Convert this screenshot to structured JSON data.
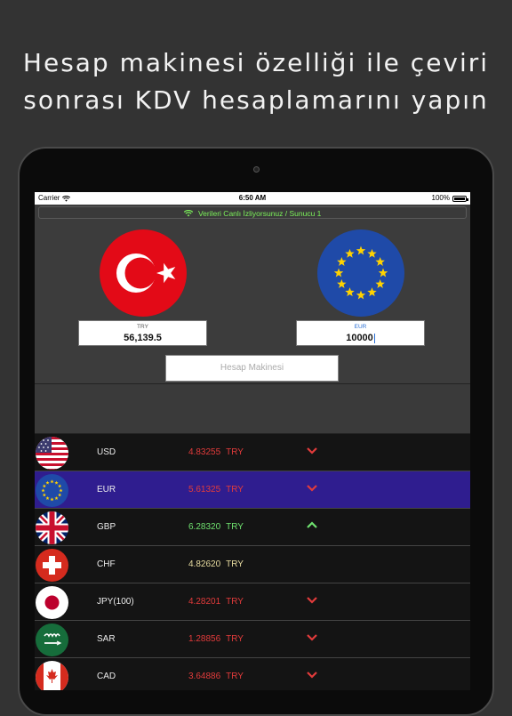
{
  "headline": {
    "line1": "Hesap makinesi özelliği ile çeviri",
    "line2": "sonrası KDV hesaplamarını yapın"
  },
  "status_bar": {
    "carrier": "Carrier",
    "time": "6:50 AM",
    "battery": "100%"
  },
  "live_banner": "Verileri Canlı İzliyorsunuz / Sunucu 1",
  "converter": {
    "from": {
      "code": "TRY",
      "value": "56,139.5",
      "flag": "turkey-flag"
    },
    "to": {
      "code": "EUR",
      "value": "10000",
      "flag": "eu-flag"
    }
  },
  "calculator_button": "Hesap Makinesi",
  "colors": {
    "up": "#6fe26f",
    "down": "#e23b3b",
    "neutral": "#e8dca0",
    "selected_row": "#2f1d8f",
    "live_text": "#7cf25a"
  },
  "rates": [
    {
      "code": "USD",
      "rate": "4.83255",
      "unit": "TRY",
      "trend": "down",
      "icon": "us-flag-icon"
    },
    {
      "code": "EUR",
      "rate": "5.61325",
      "unit": "TRY",
      "trend": "down",
      "icon": "eu-flag-icon",
      "selected": true
    },
    {
      "code": "GBP",
      "rate": "6.28320",
      "unit": "TRY",
      "trend": "up",
      "icon": "uk-flag-icon"
    },
    {
      "code": "CHF",
      "rate": "4.82620",
      "unit": "TRY",
      "trend": "none",
      "icon": "swiss-flag-icon"
    },
    {
      "code": "JPY(100)",
      "rate": "4.28201",
      "unit": "TRY",
      "trend": "down",
      "icon": "japan-flag-icon"
    },
    {
      "code": "SAR",
      "rate": "1.28856",
      "unit": "TRY",
      "trend": "down",
      "icon": "saudi-flag-icon"
    },
    {
      "code": "CAD",
      "rate": "3.64886",
      "unit": "TRY",
      "trend": "down",
      "icon": "canada-flag-icon"
    }
  ]
}
